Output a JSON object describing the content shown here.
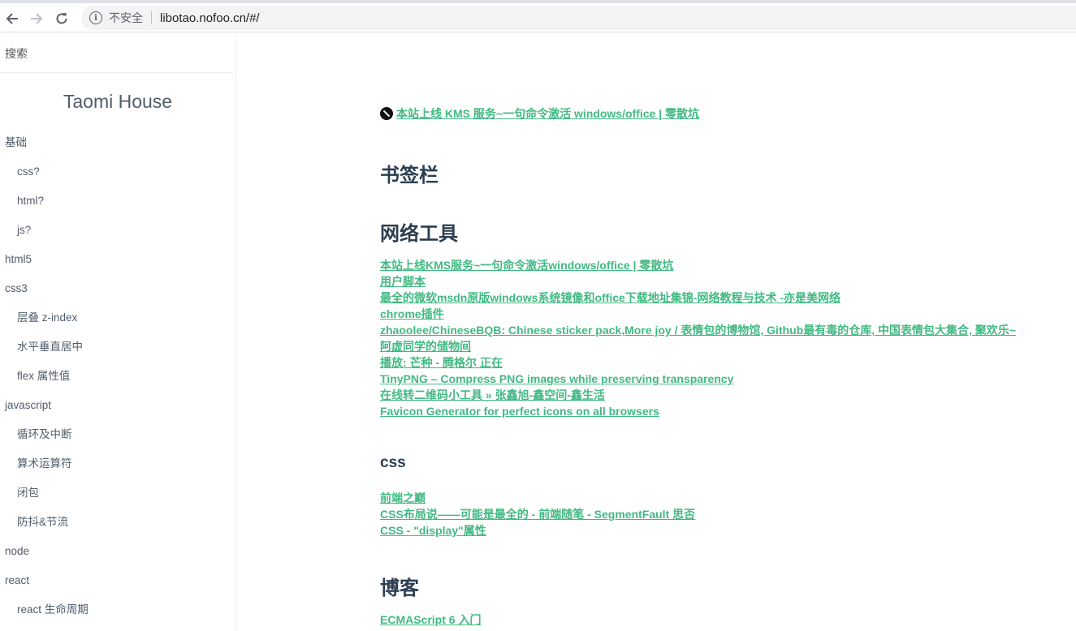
{
  "browser": {
    "insecure_label": "不安全",
    "url": "libotao.nofoo.cn/#/"
  },
  "sidebar": {
    "search_placeholder": "搜索",
    "title": "Taomi House",
    "items": [
      {
        "label": "基础",
        "level": 1
      },
      {
        "label": "css?",
        "level": 2
      },
      {
        "label": "html?",
        "level": 2
      },
      {
        "label": "js?",
        "level": 2
      },
      {
        "label": "html5",
        "level": 1
      },
      {
        "label": "css3",
        "level": 1
      },
      {
        "label": "层叠 z-index",
        "level": 2
      },
      {
        "label": "水平垂直居中",
        "level": 2
      },
      {
        "label": "flex 属性值",
        "level": 2
      },
      {
        "label": "javascript",
        "level": 1
      },
      {
        "label": "循环及中断",
        "level": 2
      },
      {
        "label": "算术运算符",
        "level": 2
      },
      {
        "label": "闭包",
        "level": 2
      },
      {
        "label": "防抖&节流",
        "level": 2
      },
      {
        "label": "node",
        "level": 1
      },
      {
        "label": "react",
        "level": 1
      },
      {
        "label": "react 生命周期",
        "level": 2
      }
    ]
  },
  "content": {
    "top_link": "本站上线 KMS 服务~一句命令激活 windows/office | 零散坑",
    "bookmarks_heading": "书签栏",
    "tools_heading": "网络工具",
    "tools_links": [
      "本站上线KMS服务~一句命令激活windows/office | 零散坑",
      "用户脚本",
      "最全的微软msdn原版windows系统镜像和office下载地址集锦-网络教程与技术 -亦是美网络",
      "chrome插件",
      "zhaoolee/ChineseBQB: Chinese sticker pack,More joy / 表情包的博物馆, Github最有毒的仓库, 中国表情包大集合, 聚欢乐~",
      "阿虚同学的储物间",
      "播放: 芒种 - 腾格尔 正在",
      "TinyPNG – Compress PNG images while preserving transparency",
      "在线转二维码小工具 » 张鑫旭-鑫空间-鑫生活",
      "Favicon Generator for perfect icons on all browsers"
    ],
    "css_heading": "css",
    "css_links": [
      "前端之巅",
      "CSS布局说——可能是最全的 - 前端随笔 - SegmentFault 思否",
      "CSS - \"display\"属性"
    ],
    "blog_heading": "博客",
    "blog_links": [
      "ECMAScript 6 入门"
    ]
  }
}
